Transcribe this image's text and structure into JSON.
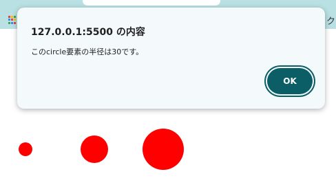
{
  "dialog": {
    "title": "127.0.0.1:5500 の内容",
    "message": "このcircle要素の半径は30です。",
    "ok_label": "OK"
  },
  "browser": {
    "bookmark_fragment": "ク"
  },
  "colors": {
    "accent": "#0b5e66",
    "circle_fill": "#ff0000",
    "browser_bar": "#b9e0e3",
    "apps_icon": [
      "#ea4335",
      "#fbbc05",
      "#34a853",
      "#4285f4",
      "#ea4335",
      "#fbbc05",
      "#34a853",
      "#4285f4",
      "#ea4335"
    ]
  },
  "circles": [
    {
      "r": 10
    },
    {
      "r": 20
    },
    {
      "r": 30
    }
  ]
}
